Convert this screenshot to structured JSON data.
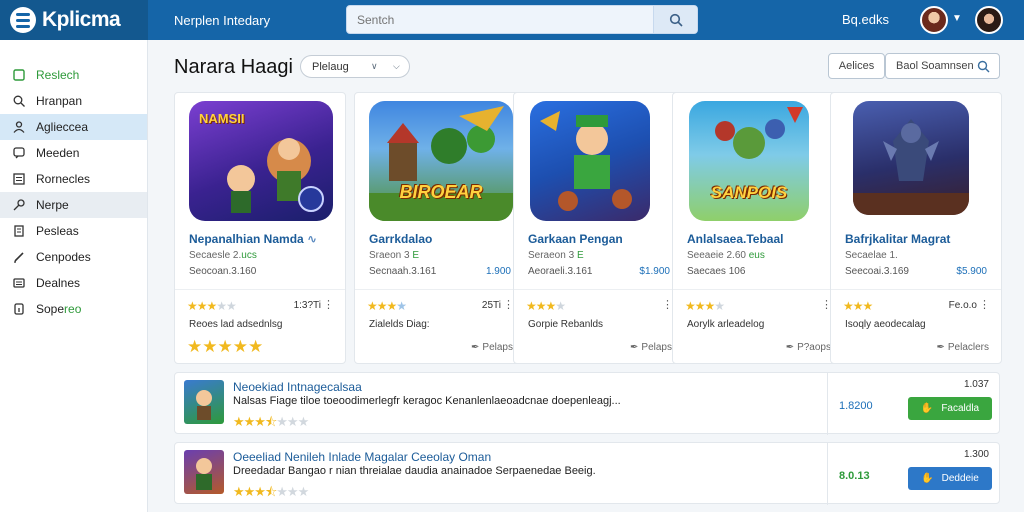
{
  "header": {
    "logo_text": "Kplicma",
    "nav_title": "Nerplen Intedary",
    "search_placeholder": "Sentch",
    "user_name": "Bq.edks"
  },
  "sidebar": {
    "items": [
      {
        "label": "Reslech",
        "icon": "square-icon"
      },
      {
        "label": "Hranpan",
        "icon": "search-icon"
      },
      {
        "label": "Aglieccea",
        "icon": "person-icon"
      },
      {
        "label": "Meeden",
        "icon": "chat-icon"
      },
      {
        "label": "Rornecles",
        "icon": "list-icon"
      },
      {
        "label": "Nerpe",
        "icon": "key-icon"
      },
      {
        "label": "Pesleas",
        "icon": "document-icon"
      },
      {
        "label": "Cenpodes",
        "icon": "pen-icon"
      },
      {
        "label": "Dealnes",
        "icon": "keyboard-icon"
      },
      {
        "label_prefix": "Sope",
        "label_suffix": "reo",
        "icon": "info-icon"
      }
    ]
  },
  "main": {
    "title": "Narara Haagi",
    "filter_label": "Plelaug",
    "action_label": "Aelices",
    "search2_label": "Baol Soamnsen"
  },
  "cards": [
    {
      "image_top": "#6a2bb8",
      "image_bottom": "#1a1f6b",
      "image_text": "NAMSII",
      "title": "Nepanalhian Namda",
      "sub": "Secaesle 2.",
      "sub_green": "ucs",
      "meta": "Seocoan.3.160",
      "price": "",
      "rating": 3,
      "count": "1:3?Ti",
      "desc": "Reoes lad adsednlsg",
      "big_stars": "★★★★★",
      "link": ""
    },
    {
      "image_top": "#2e6fd0",
      "image_bottom": "#5a9a3a",
      "image_text": "BIROEAR",
      "title": "Garrkdalao",
      "sub": "Sraeon 3",
      "sub_green": "E",
      "meta": "Secnaah.3.161",
      "price": "1.900",
      "rating": 4,
      "count": "25Ti",
      "desc": "Zialelds Diag:",
      "big_stars": "",
      "link": "Pelaps"
    },
    {
      "image_top": "#1e5fd0",
      "image_bottom": "#3b2a6a",
      "image_text": "",
      "title": "Garkaan Pengan",
      "sub": "Seraeon 3",
      "sub_green": "E",
      "meta": "Aeoraeli.3.161",
      "price": "$1.900",
      "rating": 3,
      "count": "",
      "desc": "Gorpie Rebanlds",
      "big_stars": "",
      "link": "Pelaps"
    },
    {
      "image_top": "#3aa7e0",
      "image_bottom": "#8fcf6a",
      "image_text": "SANPOIS",
      "title": "Anlalsaea.Tebaal",
      "sub": "Seeaeie 2.60",
      "sub_green": "eus",
      "meta": "Saecaes 106",
      "price": "",
      "rating": 3,
      "count": "",
      "desc": "Aorylk arleadelog",
      "big_stars": "",
      "link": "P?aops"
    },
    {
      "image_top": "#3a3f8a",
      "image_bottom": "#2a1a3a",
      "image_text": "",
      "title": "Bafrjkalitar Magrat",
      "sub": "Secaelae 1.",
      "sub_green": "",
      "meta": "Seecoai.3.169",
      "price": "$5.900",
      "rating": 3,
      "count": "Fe.o.o",
      "desc": "Isoqly aeodecalag",
      "big_stars": "",
      "link": "Pelaclers"
    }
  ],
  "rows": [
    {
      "title": "Neoekiad Intnagecalsaa",
      "desc": "Nalsas Fiage tiloe toeoodimerlegfr keragoc Kenanlenlaeoadcnae doepenleagj...",
      "rating": 3.5,
      "count": "1.037",
      "price": "1.8200",
      "price_green": false,
      "button_label": "Facaldla",
      "button_color": "green"
    },
    {
      "title": "Oeeeliad Nenileh Inlade Magalar Ceeolay Oman",
      "desc": "Dreedadar Bangao r nian threialae daudia anainadoe Serpaenedae Beeig.",
      "rating": 3.5,
      "count": "1.300",
      "price": "8.0.13",
      "price_green": true,
      "button_label": "Deddeie",
      "button_color": "blue"
    }
  ]
}
